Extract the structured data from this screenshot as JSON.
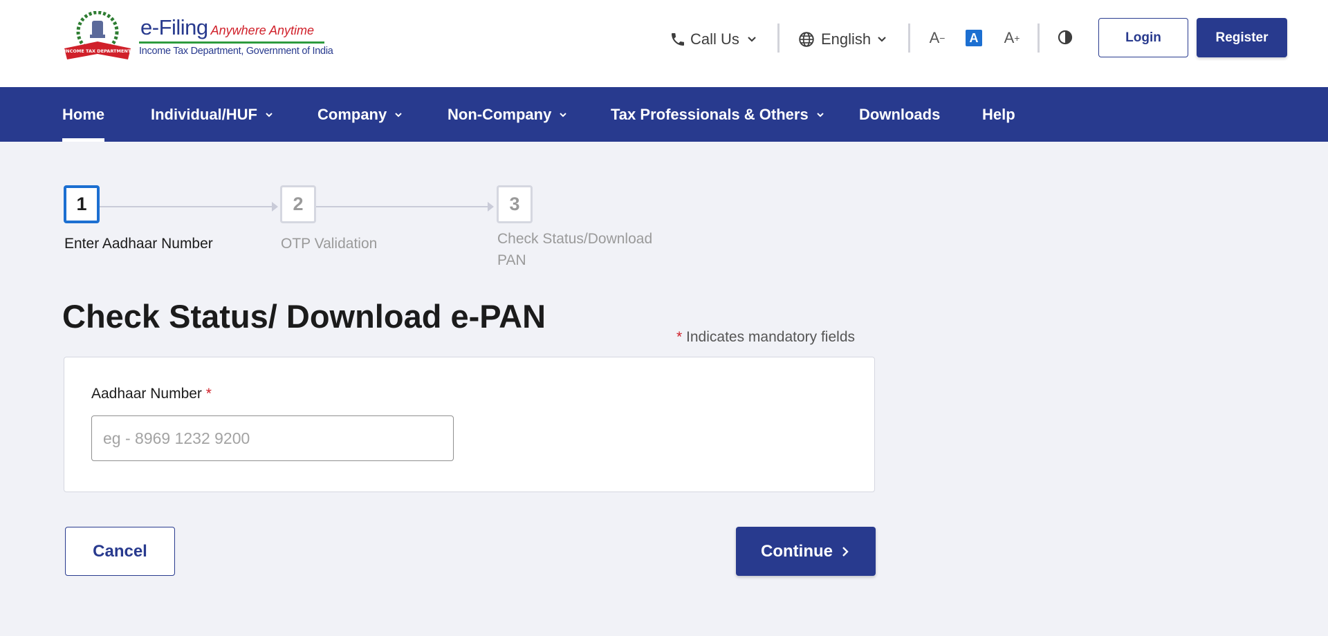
{
  "header": {
    "brand_title": "e-Filing",
    "brand_tagline": "Anywhere Anytime",
    "brand_subtitle": "Income Tax Department, Government of India",
    "emblem_text": "INCOME TAX DEPARTMENT",
    "call_us": "Call Us",
    "language": "English",
    "font_decrease": "A",
    "font_normal": "A",
    "font_increase": "A",
    "login_label": "Login",
    "register_label": "Register"
  },
  "nav": {
    "items": [
      {
        "label": "Home",
        "active": true,
        "dropdown": false
      },
      {
        "label": "Individual/HUF",
        "dropdown": true
      },
      {
        "label": "Company",
        "dropdown": true
      },
      {
        "label": "Non-Company",
        "dropdown": true
      },
      {
        "label": "Tax Professionals & Others",
        "dropdown": true
      },
      {
        "label": "Downloads",
        "dropdown": false
      },
      {
        "label": "Help",
        "dropdown": false
      }
    ]
  },
  "stepper": {
    "steps": [
      {
        "number": "1",
        "label": "Enter Aadhaar Number",
        "active": true
      },
      {
        "number": "2",
        "label": "OTP Validation",
        "active": false
      },
      {
        "number": "3",
        "label_line1": "Check Status/Download",
        "label_line2": "PAN",
        "active": false
      }
    ]
  },
  "form": {
    "title": "Check Status/ Download e-PAN",
    "mandatory_star": "*",
    "mandatory_note": "Indicates mandatory fields",
    "aadhaar_label": "Aadhaar Number",
    "aadhaar_required": "*",
    "aadhaar_value": "",
    "aadhaar_placeholder": "eg - 8969 1232 9200",
    "cancel_label": "Cancel",
    "continue_label": "Continue"
  },
  "colors": {
    "primary": "#283a8e",
    "active_step": "#1c6fd1",
    "required": "#d0202a",
    "background": "#f1f2f7"
  }
}
